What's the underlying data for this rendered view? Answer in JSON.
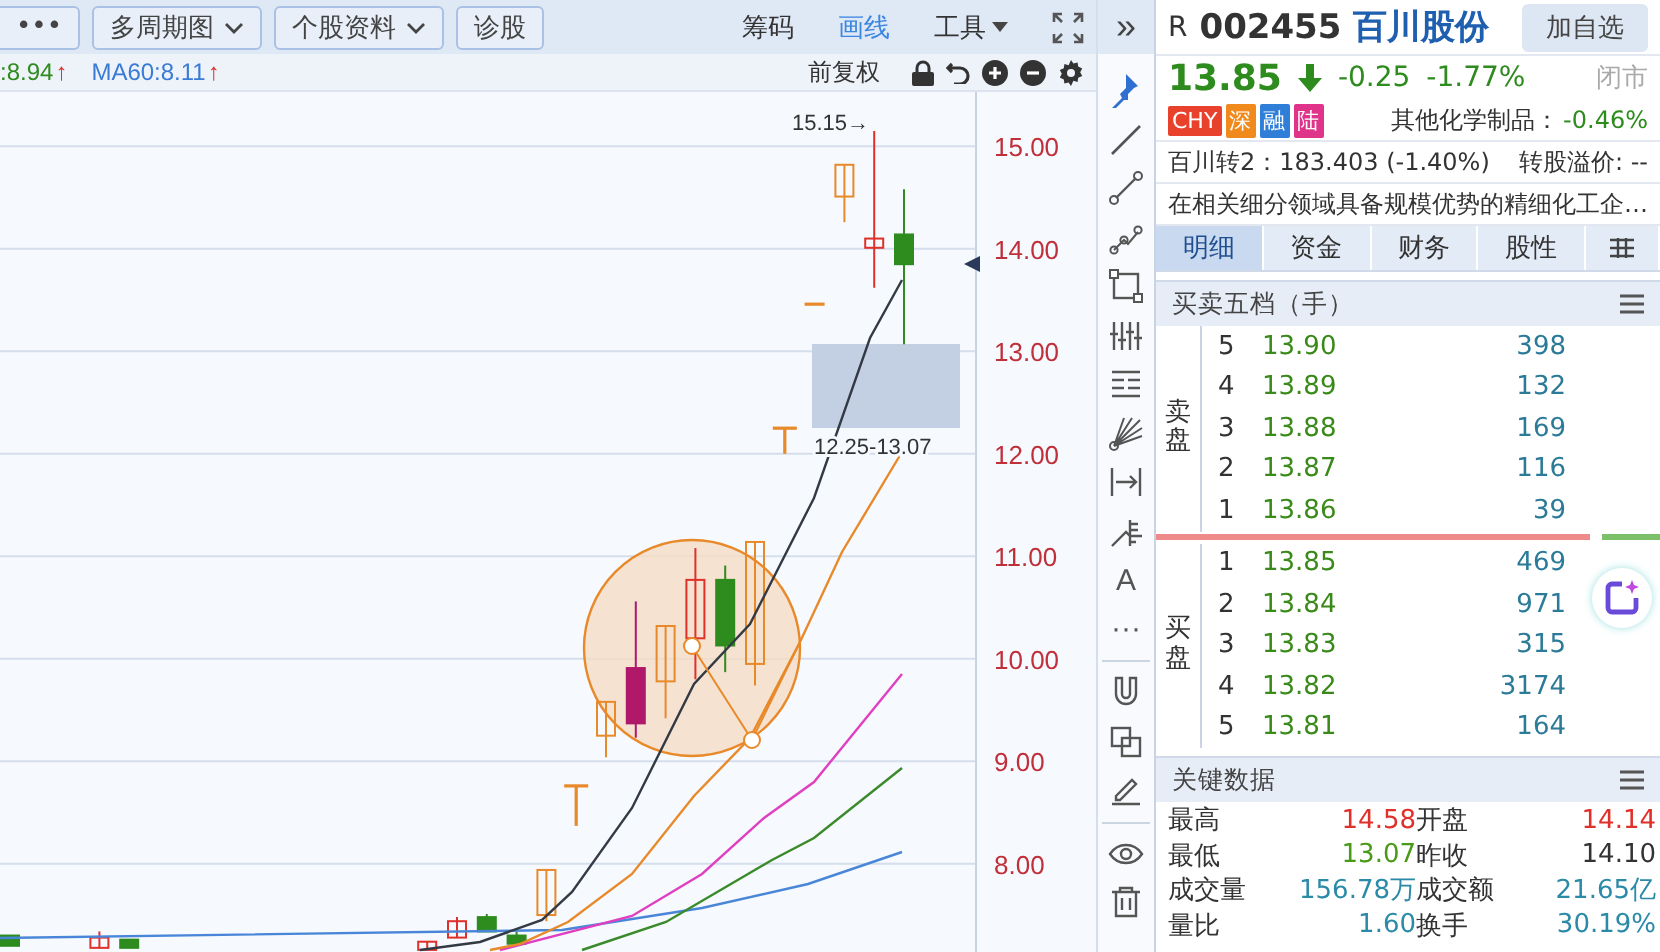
{
  "chart_toolbar": {
    "buttons": [
      {
        "label": "•••",
        "dropdown": false
      },
      {
        "label": "多周期图",
        "dropdown": true
      },
      {
        "label": "个股资料",
        "dropdown": true
      },
      {
        "label": "诊股",
        "dropdown": false
      }
    ],
    "tabs": [
      {
        "label": "筹码",
        "selected": false,
        "dropdown": false
      },
      {
        "label": "画线",
        "selected": true,
        "dropdown": false
      },
      {
        "label": "工具",
        "selected": false,
        "dropdown": true
      }
    ]
  },
  "ma_legend": [
    {
      "text": ":8.94",
      "trend": "↑",
      "color": "#2e8b1e"
    },
    {
      "text": "MA60:8.11",
      "trend": "↑",
      "color": "#3a7bd5"
    }
  ],
  "adjust_label": "前复权",
  "chart": {
    "high_marker": "15.15→",
    "range_label": "12.25-13.07",
    "chart_data": {
      "type": "candlestick",
      "grid": true,
      "ohlc": [
        [
          7.3,
          7.3,
          7.2,
          7.2
        ],
        null,
        null,
        [
          7.18,
          7.34,
          7.18,
          7.28
        ],
        [
          7.26,
          7.26,
          7.18,
          7.18
        ],
        null,
        null,
        null,
        null,
        null,
        null,
        null,
        null,
        null,
        [
          7.16,
          7.24,
          7.16,
          7.24
        ],
        [
          7.28,
          7.48,
          7.28,
          7.44
        ],
        [
          7.48,
          7.51,
          7.34,
          7.34
        ],
        [
          7.3,
          7.34,
          7.22,
          7.22
        ],
        [
          7.5,
          7.94,
          7.44,
          7.94
        ],
        [
          8.76,
          8.76,
          8.37,
          8.76
        ],
        [
          9.25,
          9.58,
          9.04,
          9.58
        ],
        [
          9.91,
          10.56,
          9.23,
          9.37
        ],
        [
          9.78,
          10.32,
          9.42,
          10.32
        ],
        [
          10.2,
          11.08,
          9.8,
          10.77
        ],
        [
          10.77,
          10.91,
          9.87,
          10.13
        ],
        [
          9.95,
          11.14,
          9.74,
          11.14
        ],
        [
          12.25,
          12.25,
          12.0,
          12.25
        ],
        [
          13.46,
          13.46,
          13.46,
          13.46
        ],
        [
          14.51,
          14.82,
          14.26,
          14.82
        ],
        [
          14.01,
          15.15,
          13.62,
          14.1
        ],
        [
          14.14,
          14.58,
          13.07,
          13.85
        ]
      ],
      "colors": [
        "#2e8b1e",
        null,
        null,
        "#e0302a",
        "#2e8b1e",
        null,
        null,
        null,
        null,
        null,
        null,
        null,
        null,
        null,
        "#e0302a",
        "#e0302a",
        "#2e8b1e",
        "#2e8b1e",
        "#e8892a",
        "#e8892a",
        "#e8892a",
        "#b0186a",
        "#e8892a",
        "#e0302a",
        "#2e8b1e",
        "#e8892a",
        "#e8892a",
        "#e8892a",
        "#e8892a",
        "#e0302a",
        "#2e8b1e"
      ],
      "ylim": [
        7.12,
        15.53
      ],
      "yticks": [
        {
          "value": 15,
          "label": "15.00"
        },
        {
          "value": 14,
          "label": "14.00"
        },
        {
          "value": 13,
          "label": "13.00"
        },
        {
          "value": 12,
          "label": "12.00"
        },
        {
          "value": 11,
          "label": "11.00"
        },
        {
          "value": 10,
          "label": "10.00"
        },
        {
          "value": 9,
          "label": "9.00"
        },
        {
          "value": 8,
          "label": "8.00"
        }
      ]
    }
  },
  "panel_toggle": "»",
  "drawing_tools": [
    {
      "kind": "pin"
    },
    {
      "kind": "line"
    },
    {
      "kind": "segment"
    },
    {
      "kind": "polyline"
    },
    {
      "kind": "rectangle"
    },
    {
      "kind": "bars"
    },
    {
      "kind": "note"
    },
    {
      "kind": "fan"
    },
    {
      "kind": "span"
    },
    {
      "kind": "ruler"
    },
    {
      "kind": "glyph",
      "label": "A"
    },
    {
      "kind": "glyph",
      "label": "···"
    },
    {
      "kind": "divider"
    },
    {
      "kind": "magnet"
    },
    {
      "kind": "copy"
    },
    {
      "kind": "pencil"
    },
    {
      "kind": "divider"
    },
    {
      "kind": "eye"
    },
    {
      "kind": "trash"
    }
  ],
  "quote": {
    "prefix": "R",
    "code": "002455",
    "name": "百川股份",
    "watch_button": "加自选",
    "price": "13.85",
    "down": true,
    "change": "-0.25",
    "change_pct": "-1.77%",
    "status": "闭市",
    "badges": [
      {
        "text": "CHY",
        "color": "#e8412c"
      },
      {
        "text": "深",
        "color": "#f08a1c"
      },
      {
        "text": "融",
        "color": "#2f7fd8"
      },
      {
        "text": "陆",
        "color": "#e0338a"
      }
    ],
    "sector": "其他化学制品：",
    "sector_change": "-0.46%",
    "bond": "百川转2：183.403 (-1.40%)",
    "premium": "转股溢价: --",
    "description": "在相关细分领域具备规模优势的精细化工企…"
  },
  "tabs": [
    {
      "label": "明细",
      "selected": true
    },
    {
      "label": "资金",
      "selected": false
    },
    {
      "label": "财务",
      "selected": false
    },
    {
      "label": "股性",
      "selected": false
    }
  ],
  "order_book": {
    "title": "买卖五档（手）",
    "ask_label": "卖盘",
    "bid_label": "买盘",
    "asks": [
      {
        "rank": "5",
        "price": "13.90",
        "volume": "398"
      },
      {
        "rank": "4",
        "price": "13.89",
        "volume": "132"
      },
      {
        "rank": "3",
        "price": "13.88",
        "volume": "169"
      },
      {
        "rank": "2",
        "price": "13.87",
        "volume": "116"
      },
      {
        "rank": "1",
        "price": "13.86",
        "volume": "39"
      }
    ],
    "balance": {
      "level": 0.86
    },
    "bids": [
      {
        "rank": "1",
        "price": "13.85",
        "volume": "469"
      },
      {
        "rank": "2",
        "price": "13.84",
        "volume": "971"
      },
      {
        "rank": "3",
        "price": "13.83",
        "volume": "315"
      },
      {
        "rank": "4",
        "price": "13.82",
        "volume": "3174"
      },
      {
        "rank": "5",
        "price": "13.81",
        "volume": "164"
      }
    ]
  },
  "key_data": {
    "title": "关键数据",
    "rows": [
      [
        {
          "label": "最高",
          "value": "14.58",
          "color": "#e0302a"
        },
        {
          "label": "开盘",
          "value": "14.14",
          "color": "#e0302a"
        }
      ],
      [
        {
          "label": "最低",
          "value": "13.07",
          "color": "#4a9a1a"
        },
        {
          "label": "昨收",
          "value": "14.10",
          "color": "#333333"
        }
      ],
      [
        {
          "label": "成交量",
          "value": "156.78万",
          "color": "#2a8aa8"
        },
        {
          "label": "成交额",
          "value": "21.65亿",
          "color": "#2a8aa8"
        }
      ],
      [
        {
          "label": "量比",
          "value": "1.60",
          "color": "#2a8aa8"
        },
        {
          "label": "换手",
          "value": "30.19%",
          "color": "#2a8aa8"
        }
      ]
    ]
  }
}
